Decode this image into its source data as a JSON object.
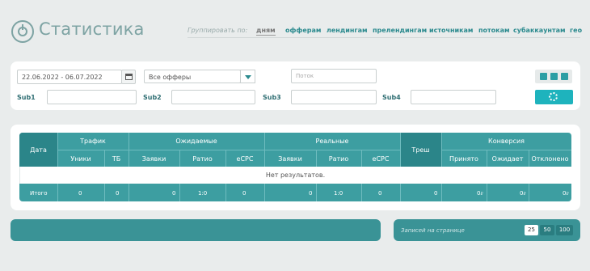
{
  "header": {
    "title": "Статистика",
    "group_label": "Группировать по:",
    "group_links": [
      "дням",
      "офферам",
      "лендингам",
      "прелендингам",
      "источникам",
      "потокам",
      "субаккаунтам",
      "гео"
    ]
  },
  "filters": {
    "date_range": "22.06.2022 - 06.07.2022",
    "offers_selected": "Все офферы",
    "stream_placeholder": "Поток",
    "sub_labels": [
      "Sub1",
      "Sub2",
      "Sub3",
      "Sub4"
    ]
  },
  "table": {
    "date_header": "Дата",
    "groups": [
      "Трафик",
      "Ожидаемые",
      "Реальные",
      "Треш",
      "Конверсия"
    ],
    "columns": [
      "Уники",
      "ТБ",
      "Заявки",
      "Ратио",
      "eCPC",
      "Заявки",
      "Ратио",
      "eCPC",
      "Принято",
      "Ожидает",
      "Отклонено"
    ],
    "empty_text": "Нет результатов.",
    "total": {
      "label": "Итого",
      "values": [
        "0",
        "0",
        "0",
        "1:0",
        "0",
        "0",
        "1:0",
        "0",
        "0",
        "0",
        "0",
        "0"
      ],
      "currency": "₽"
    }
  },
  "pagination": {
    "label": "Записей на странице",
    "sizes": [
      "25",
      "50",
      "100"
    ],
    "active": "25"
  },
  "colors": {
    "accent": "#3d9ea1",
    "accent_dark": "#2b8589",
    "button": "#1eb3bd",
    "background": "#e9ecec"
  },
  "icons": [
    "logo-icon",
    "calendar-icon",
    "chevron-down-icon",
    "view-icon",
    "refresh-icon"
  ]
}
